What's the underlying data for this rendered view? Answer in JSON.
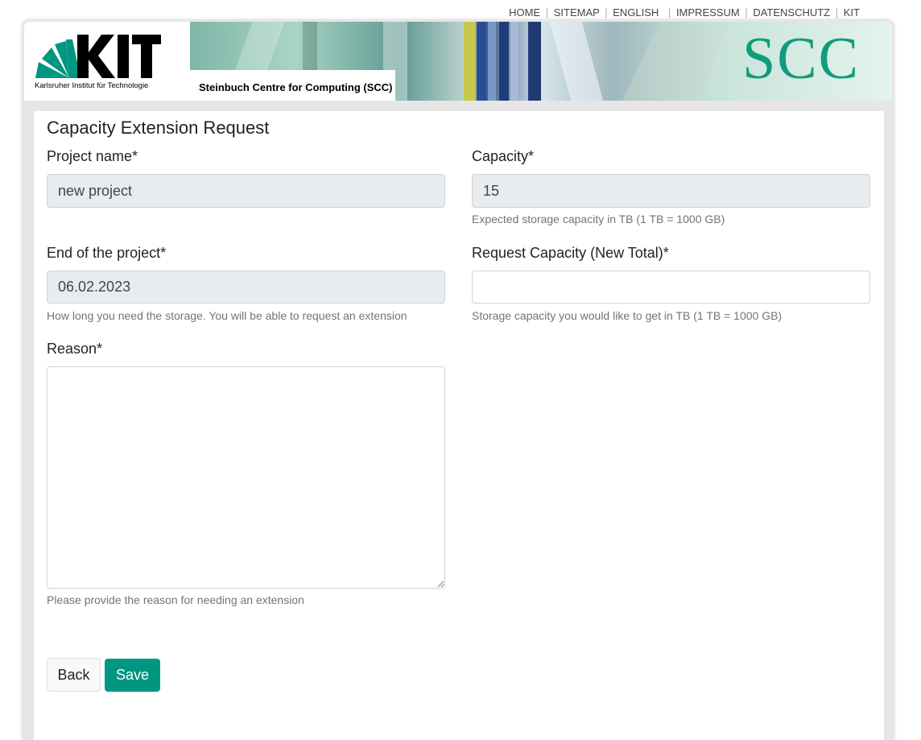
{
  "topnav": {
    "home": "HOME",
    "sitemap": "SITEMAP",
    "english": "ENGLISH",
    "impressum": "IMPRESSUM",
    "datenschutz": "DATENSCHUTZ",
    "kit": "KIT",
    "separator": "|"
  },
  "header": {
    "logo_text": "KIT",
    "logo_subtitle": "Karlsruher Institut für Technologie",
    "banner_label": "Steinbuch Centre for Computing (SCC)",
    "scc_logo_text": "SCC",
    "brand_color": "#009682"
  },
  "form": {
    "title": "Capacity Extension Request",
    "project_name": {
      "label": "Project name*",
      "value": "new project"
    },
    "capacity": {
      "label": "Capacity*",
      "value": "15",
      "help": "Expected storage capacity in TB (1 TB = 1000 GB)"
    },
    "end_of_project": {
      "label": "End of the project*",
      "value": "06.02.2023",
      "help": "How long you need the storage. You will be able to request an extension"
    },
    "request_capacity": {
      "label": "Request Capacity (New Total)*",
      "value": "",
      "help": "Storage capacity you would like to get in TB (1 TB = 1000 GB)"
    },
    "reason": {
      "label": "Reason*",
      "value": "",
      "help": "Please provide the reason for needing an extension"
    },
    "back_label": "Back",
    "save_label": "Save"
  }
}
